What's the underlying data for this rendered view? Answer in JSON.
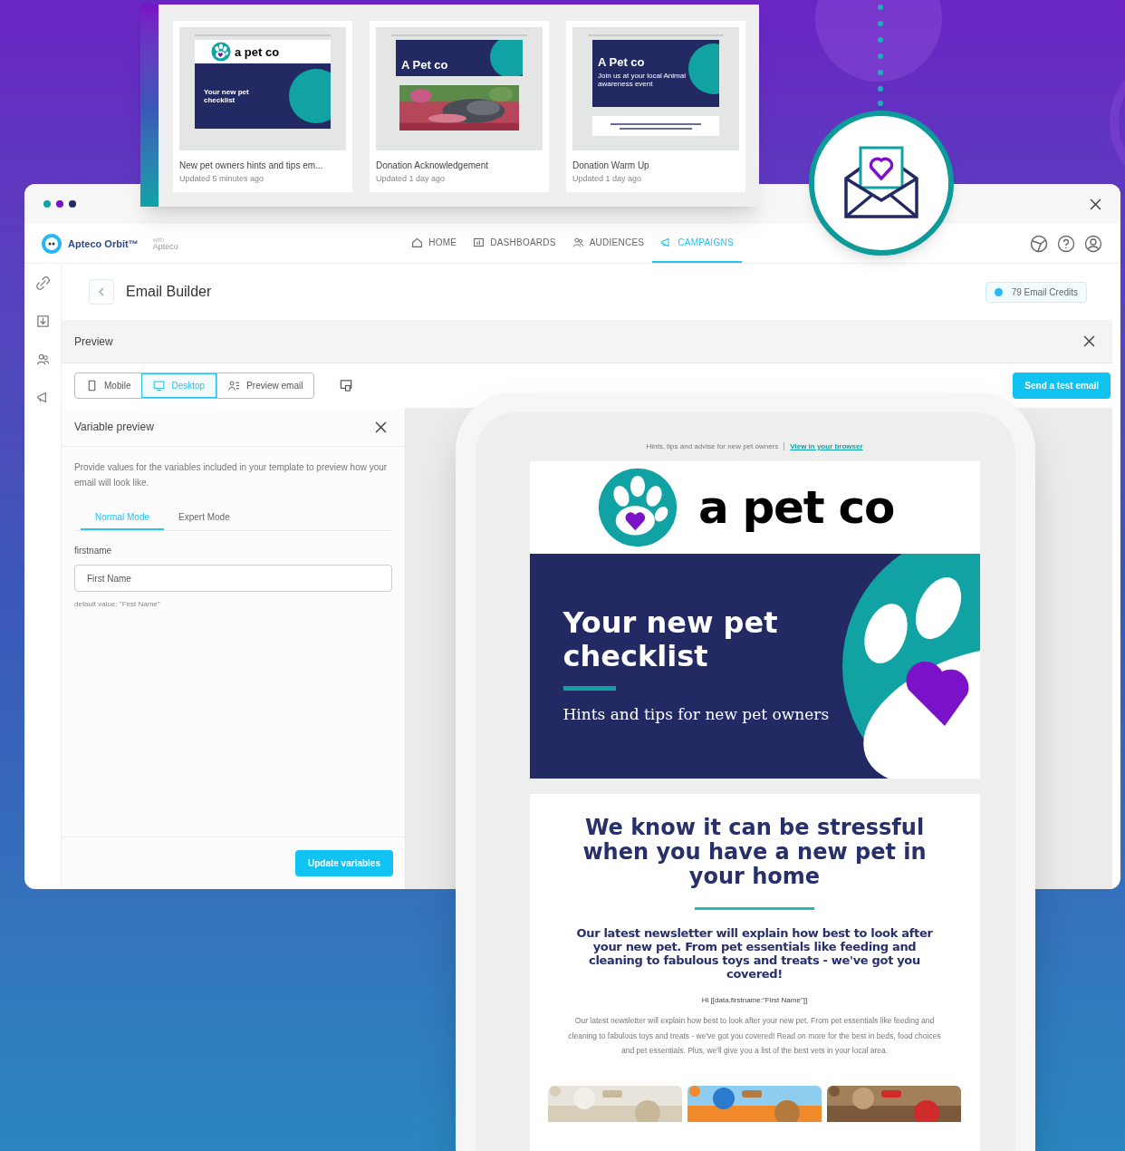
{
  "template_cards": [
    {
      "title": "New pet owners hints and tips em...",
      "updated": "Updated 5 minutes ago",
      "thumb": {
        "kind": "checklist",
        "brand": "a pet co",
        "headline": "Your new pet checklist"
      }
    },
    {
      "title": "Donation Acknowledgement",
      "updated": "Updated 1 day ago",
      "thumb": {
        "brand": "A Pet co"
      }
    },
    {
      "title": "Donation Warm Up",
      "updated": "Updated 1 day ago",
      "thumb": {
        "kind": "event",
        "brand": "A Pet co",
        "headline": "Join us at your local Animal awareness event"
      }
    }
  ],
  "app": {
    "brand": "Apteco Orbit™",
    "brand_with": "with",
    "brand_company": "Apteco",
    "nav": [
      {
        "label": "HOME",
        "selected": false
      },
      {
        "label": "DASHBOARDS",
        "selected": false
      },
      {
        "label": "AUDIENCES",
        "selected": false
      },
      {
        "label": "CAMPAIGNS",
        "selected": true
      }
    ],
    "page_title": "Email Builder",
    "credits": "79 Email Credits",
    "preview_title": "Preview",
    "view_buttons": [
      {
        "label": "Mobile",
        "selected": false
      },
      {
        "label": "Desktop",
        "selected": true
      },
      {
        "label": "Preview email",
        "selected": false
      }
    ],
    "send_button": "Send a test email"
  },
  "variable_panel": {
    "title": "Variable preview",
    "description": "Provide values for the variables included in your template to preview how your email will look like.",
    "tabs": [
      {
        "label": "Normal Mode",
        "selected": true
      },
      {
        "label": "Expert Mode",
        "selected": false
      }
    ],
    "field_label": "firstname",
    "field_value": "First Name",
    "hint": "default value: \"First Name\"",
    "button": "Update variables"
  },
  "email": {
    "preheader": "Hints, tips and advise for new pet owners",
    "preheader_link": "View in your browser",
    "brand": "a pet co",
    "hero_title": "Your new pet checklist",
    "hero_subtitle": "Hints and tips for new pet owners",
    "heading": "We know it can be stressful when you have a new pet in your home",
    "intro": "Our latest newsletter will explain how best to look after your new pet. From pet essentials like feeding and cleaning to fabulous toys and treats - we've got you covered!",
    "greeting": "Hi [[data.firstname:\"First Name\"]]",
    "body": "Our latest newsletter will explain how best to look after your new pet. From pet essentials like feeding and cleaning to fabulous toys and treats - we've got you covered! Read on more for the best in beds, food choices and pet essentials. Plus, we'll give you a list of the best vets in your local area."
  }
}
